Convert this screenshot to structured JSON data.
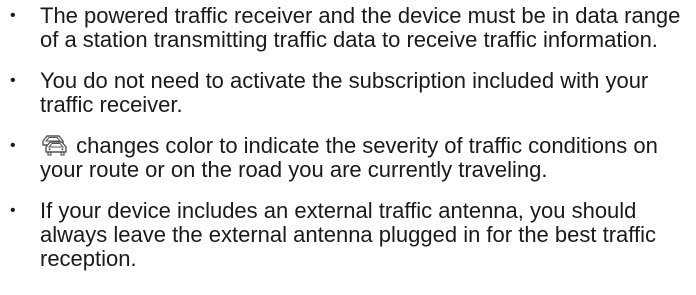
{
  "bullets": [
    {
      "text": "The powered traffic receiver and the device must be in data range of a station transmitting traffic data to receive traffic information."
    },
    {
      "text": "You do not need to activate the subscription included with your traffic receiver."
    },
    {
      "icon": "traffic-icon",
      "text": "changes color to indicate the severity of traffic conditions on your route or on the road you are currently traveling."
    },
    {
      "text": "If your device includes an external traffic antenna, you should always leave the external antenna plugged in for the best traffic reception."
    }
  ],
  "bullet_glyph": "•"
}
